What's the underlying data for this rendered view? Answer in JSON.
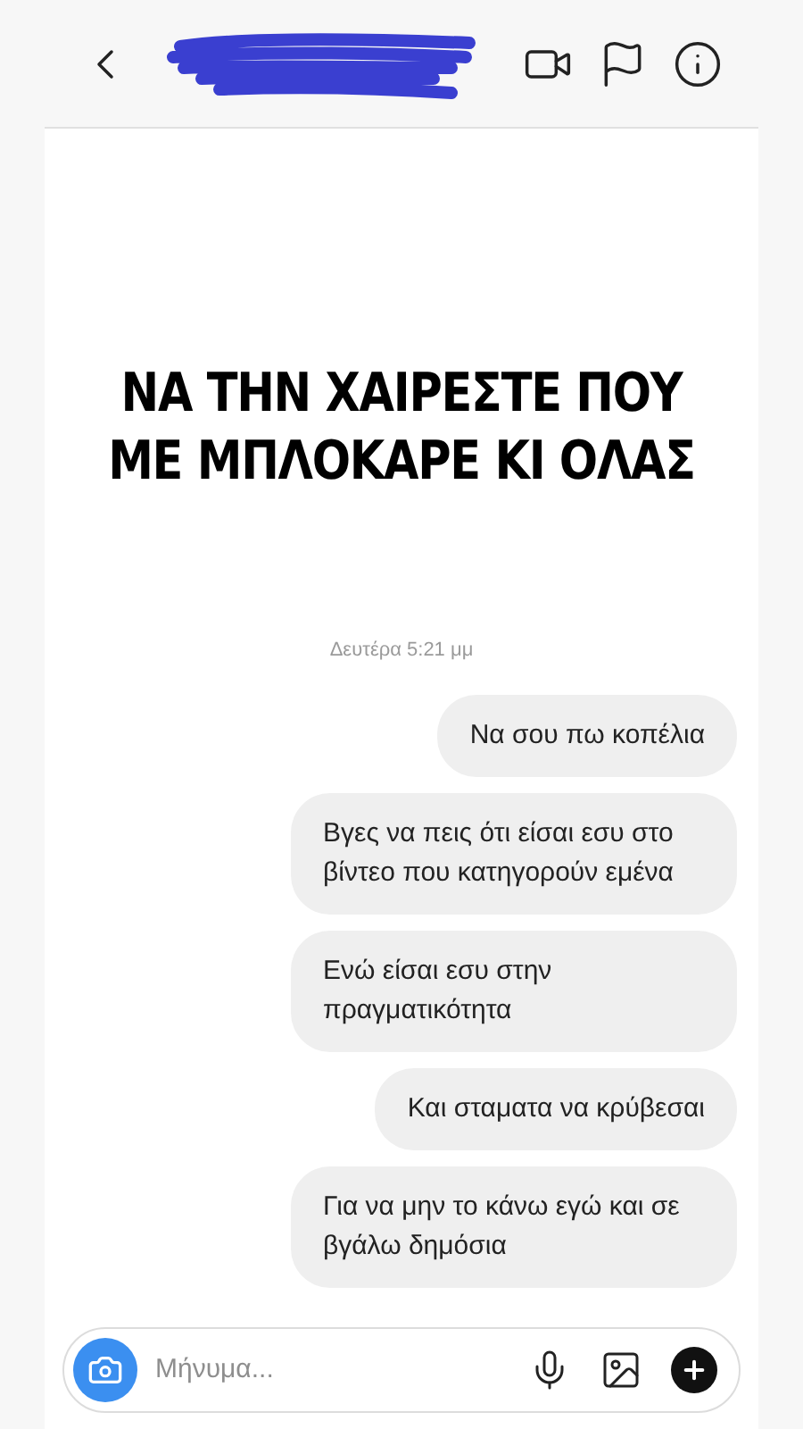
{
  "caption": [
    "ΝΑ ΤΗΝ ΧΑΙΡΕΣΤΕ ΠΟΥ",
    "ΜΕ ΜΠΛΟΚΑΡΕ ΚΙ ΟΛΑΣ"
  ],
  "timestamp": "Δευτέρα 5:21 μμ",
  "messages": [
    {
      "text": "Να σου πω κοπέλια"
    },
    {
      "text": "Βγες να πεις ότι είσαι εσυ στο βίντεο που κατηγορούν εμένα"
    },
    {
      "text": "Ενώ είσαι εσυ στην πραγματικότητα"
    },
    {
      "text": "Και σταματα να κρύβεσαι"
    },
    {
      "text": "Για να μην το κάνω εγώ και σε βγάλω δημόσια"
    }
  ],
  "composer": {
    "placeholder": "Μήνυμα..."
  }
}
